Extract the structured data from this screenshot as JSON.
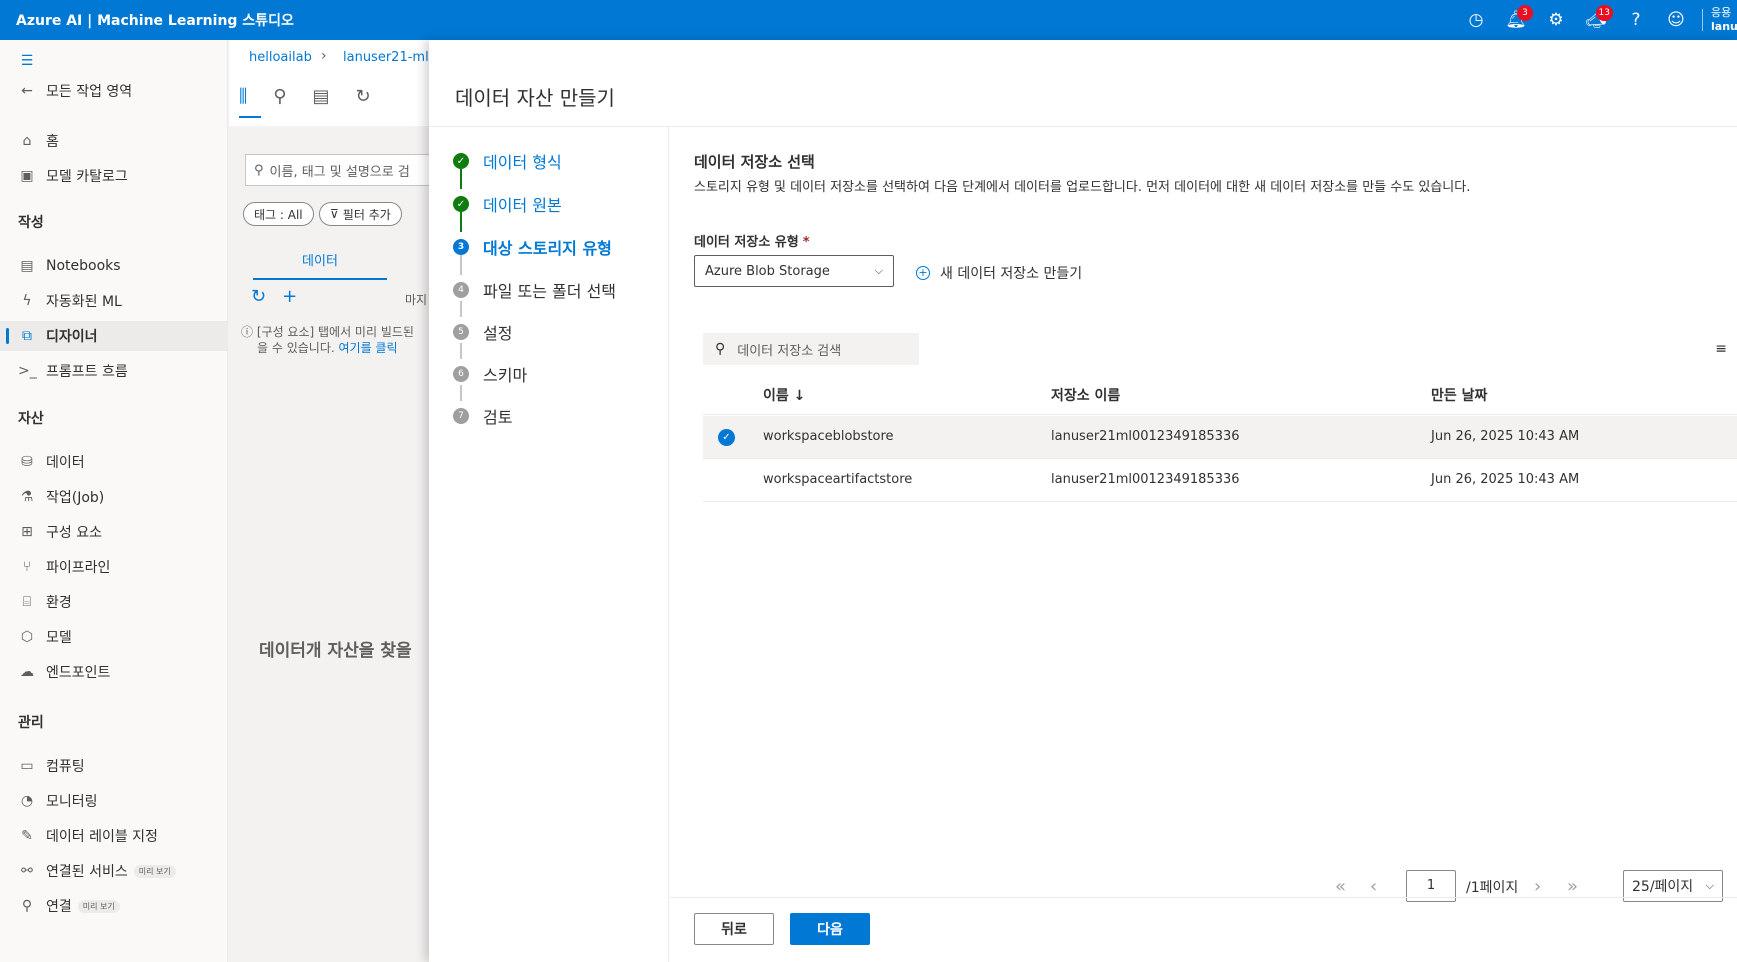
{
  "app_title": "Azure AI | Machine Learning 스튜디오",
  "topbar": {
    "notifications_count": "3",
    "announcements_count": "13",
    "user_line1": "응용",
    "user_line2": "lanu"
  },
  "sidebar": {
    "back_label": "모든 작업 영역",
    "items_top": [
      {
        "label": "홈",
        "icon": "home-icon"
      },
      {
        "label": "모델 카탈로그",
        "icon": "catalog-icon"
      }
    ],
    "section_author": "작성",
    "items_author": [
      {
        "label": "Notebooks"
      },
      {
        "label": "자동화된 ML"
      },
      {
        "label": "디자이너"
      },
      {
        "label": "프롬프트 흐름"
      }
    ],
    "section_assets": "자산",
    "items_assets": [
      {
        "label": "데이터"
      },
      {
        "label": "작업(Job)"
      },
      {
        "label": "구성 요소"
      },
      {
        "label": "파이프라인"
      },
      {
        "label": "환경"
      },
      {
        "label": "모델"
      },
      {
        "label": "엔드포인트"
      }
    ],
    "section_manage": "관리",
    "items_manage": [
      {
        "label": "컴퓨팅"
      },
      {
        "label": "모니터링"
      },
      {
        "label": "데이터 레이블 지정"
      },
      {
        "label": "연결된 서비스",
        "badge": "미리 보기"
      },
      {
        "label": "연결",
        "badge": "미리 보기"
      }
    ]
  },
  "middle": {
    "breadcrumb": [
      "helloailab",
      "lanuser21-ml-"
    ],
    "search_placeholder": "이름, 태그 및 설명으로 검",
    "chip_tag": "태그 : All",
    "chip_filter": "필터 추가",
    "tab_data": "데이터",
    "last_label": "마지",
    "info_line1": "[구성 요소] 탭에서 미리 빌드된",
    "info_line2_prefix": "을 수 있습니다. ",
    "info_link": "여기를 클릭",
    "empty_text": "데이터개 자산을 찾을"
  },
  "panel": {
    "title": "데이터 자산 만들기",
    "steps": [
      {
        "num": "✓",
        "label": "데이터 형식"
      },
      {
        "num": "✓",
        "label": "데이터 원본"
      },
      {
        "num": "3",
        "label": "대상 스토리지 유형"
      },
      {
        "num": "4",
        "label": "파일 또는 폴더 선택"
      },
      {
        "num": "5",
        "label": "설정"
      },
      {
        "num": "6",
        "label": "스키마"
      },
      {
        "num": "7",
        "label": "검토"
      }
    ],
    "section_title": "데이터 저장소 선택",
    "section_desc": "스토리지 유형 및 데이터 저장소를 선택하여 다음 단계에서 데이터를 업로드합니다. 먼저 데이터에 대한 새 데이터 저장소를 만들 수도 있습니다.",
    "store_type_label": "데이터 저장소 유형",
    "store_type_required": "*",
    "store_type_value": "Azure Blob Storage",
    "new_store_label": "새 데이터 저장소 만들기",
    "search_placeholder": "데이터 저장소 검색",
    "table": {
      "headers": [
        "이름 ↓",
        "저장소 이름",
        "만든 날짜"
      ],
      "rows": [
        {
          "name": "workspaceblobstore",
          "storage": "lanuser21ml0012349185336",
          "created": "Jun 26, 2025 10:43 AM",
          "selected": true
        },
        {
          "name": "workspaceartifactstore",
          "storage": "lanuser21ml0012349185336",
          "created": "Jun 26, 2025 10:43 AM",
          "selected": false
        }
      ]
    },
    "pager": {
      "page_value": "1",
      "page_of": "/1페이지",
      "page_size": "25/페이지"
    },
    "back_label": "뒤로",
    "next_label": "다음"
  }
}
